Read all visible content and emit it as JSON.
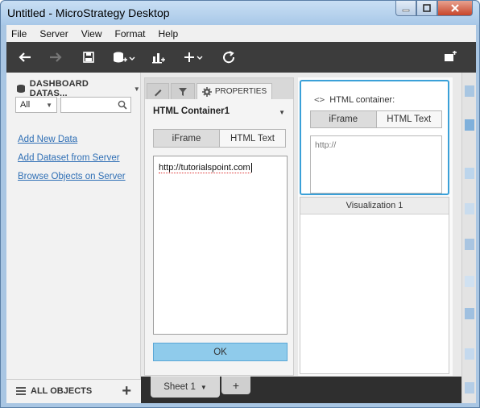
{
  "window": {
    "title": "Untitled - MicroStrategy Desktop"
  },
  "menu": {
    "items": [
      "File",
      "Server",
      "View",
      "Format",
      "Help"
    ]
  },
  "left_panel": {
    "header": "DASHBOARD DATAS...",
    "filter_value": "All",
    "search_placeholder": "",
    "links": [
      "Add New Data",
      "Add Dataset from Server",
      "Browse Objects on Server"
    ],
    "footer_label": "ALL OBJECTS"
  },
  "properties": {
    "tab_label": "PROPERTIES",
    "container_name": "HTML Container1",
    "mode_iframe": "iFrame",
    "mode_html": "HTML Text",
    "url_value": "http://tutorialspoint.com",
    "ok_label": "OK"
  },
  "canvas": {
    "container_title": "HTML container:",
    "mode_iframe": "iFrame",
    "mode_html": "HTML Text",
    "input_placeholder": "http://",
    "viz_title": "Visualization 1"
  },
  "sheets": {
    "tab_label": "Sheet 1",
    "add_label": "+"
  },
  "colors": {
    "toolbar_bg": "#3c3c3c",
    "accent": "#3aa0d8",
    "ok_button": "#8fcbeb",
    "link": "#2f6fb5"
  }
}
